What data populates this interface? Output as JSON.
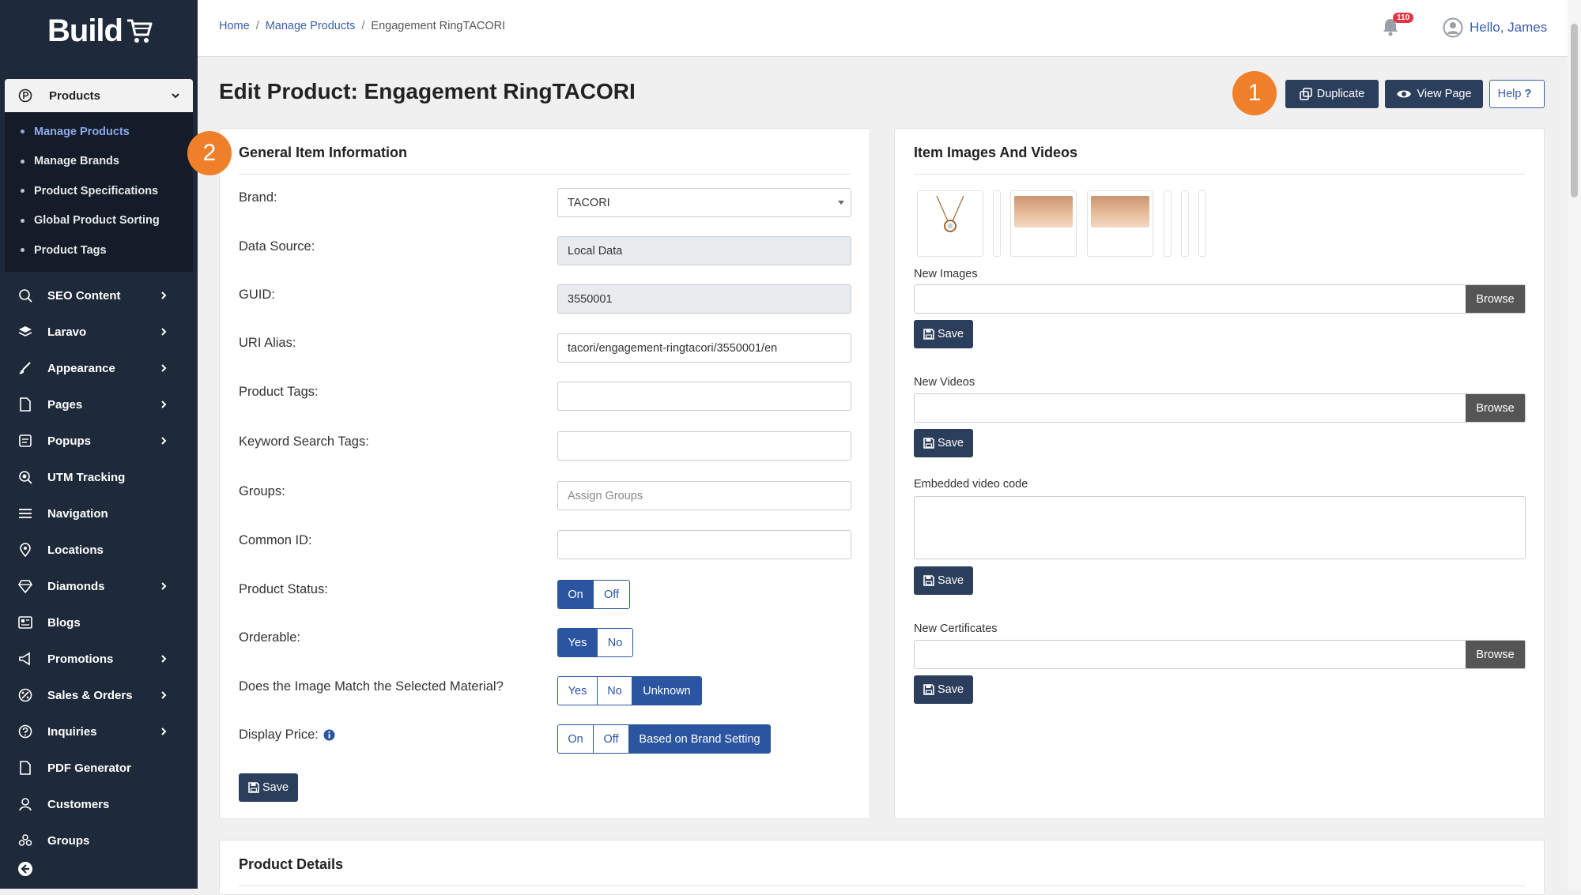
{
  "app": {
    "logo_text": "Build"
  },
  "sidebar": {
    "products": {
      "label": "Products",
      "items": [
        {
          "label": "Manage Products",
          "active": true
        },
        {
          "label": "Manage Brands"
        },
        {
          "label": "Product Specifications"
        },
        {
          "label": "Global Product Sorting"
        },
        {
          "label": "Product Tags"
        }
      ]
    },
    "nav": [
      {
        "label": "SEO Content",
        "icon": "seo-icon",
        "has_sub": true
      },
      {
        "label": "Laravo",
        "icon": "layers-icon",
        "has_sub": true
      },
      {
        "label": "Appearance",
        "icon": "brush-icon",
        "has_sub": true
      },
      {
        "label": "Pages",
        "icon": "page-icon",
        "has_sub": true
      },
      {
        "label": "Popups",
        "icon": "popup-icon",
        "has_sub": true
      },
      {
        "label": "UTM Tracking",
        "icon": "tracking-icon",
        "has_sub": false
      },
      {
        "label": "Navigation",
        "icon": "menu-icon",
        "has_sub": false
      },
      {
        "label": "Locations",
        "icon": "location-pin-icon",
        "has_sub": false
      },
      {
        "label": "Diamonds",
        "icon": "diamond-icon",
        "has_sub": true
      },
      {
        "label": "Blogs",
        "icon": "blog-icon",
        "has_sub": false
      },
      {
        "label": "Promotions",
        "icon": "megaphone-icon",
        "has_sub": true
      },
      {
        "label": "Sales & Orders",
        "icon": "sales-icon",
        "has_sub": true
      },
      {
        "label": "Inquiries",
        "icon": "question-icon",
        "has_sub": true
      },
      {
        "label": "PDF Generator",
        "icon": "pdf-icon",
        "has_sub": false
      },
      {
        "label": "Customers",
        "icon": "user-icon",
        "has_sub": false
      },
      {
        "label": "Groups",
        "icon": "groups-icon",
        "has_sub": false
      }
    ]
  },
  "topbar": {
    "breadcrumb": [
      "Home",
      "Manage Products",
      "Engagement RingTACORI"
    ],
    "notifications": "110",
    "greeting": "Hello, James"
  },
  "page": {
    "title": "Edit Product: Engagement RingTACORI",
    "buttons": {
      "duplicate": "Duplicate",
      "view": "View Page",
      "help": "Help"
    },
    "markers": [
      "1",
      "2"
    ]
  },
  "general": {
    "title": "General Item Information",
    "brand": {
      "label": "Brand:",
      "value": "TACORI"
    },
    "data_source": {
      "label": "Data Source:",
      "value": "Local Data"
    },
    "guid": {
      "label": "GUID:",
      "value": "3550001"
    },
    "uri": {
      "label": "URI Alias:",
      "value": "tacori/engagement-ringtacori/3550001/en"
    },
    "product_tags": {
      "label": "Product Tags:"
    },
    "keyword_tags": {
      "label": "Keyword Search Tags:"
    },
    "groups": {
      "label": "Groups:",
      "placeholder": "Assign Groups"
    },
    "common_id": {
      "label": "Common ID:"
    },
    "status": {
      "label": "Product Status:",
      "options": [
        "On",
        "Off"
      ],
      "selected": "On"
    },
    "orderable": {
      "label": "Orderable:",
      "options": [
        "Yes",
        "No"
      ],
      "selected": "Yes"
    },
    "image_match": {
      "label": "Does the Image Match the Selected Material?",
      "options": [
        "Yes",
        "No",
        "Unknown"
      ],
      "selected": "Unknown"
    },
    "display_price": {
      "label": "Display Price:",
      "options": [
        "On",
        "Off",
        "Based on Brand Setting"
      ],
      "selected": "Based on Brand Setting"
    },
    "save": "Save"
  },
  "images": {
    "title": "Item Images And Videos",
    "new_images": "New Images",
    "new_videos": "New Videos",
    "embedded": "Embedded video code",
    "new_certificates": "New Certificates",
    "browse": "Browse",
    "save": "Save"
  },
  "details": {
    "title": "Product Details"
  }
}
